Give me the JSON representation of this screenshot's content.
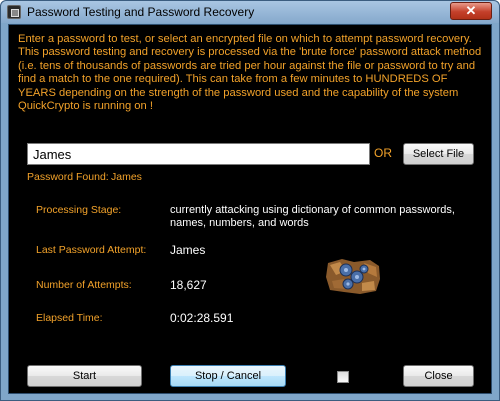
{
  "window": {
    "title": "Password Testing and Password Recovery",
    "close_glyph": "✕"
  },
  "intro_text": "Enter a password to test, or select an encrypted file on which to attempt password recovery.  This password testing and recovery is processed via the  'brute force' password attack method (i.e. tens of thousands of passwords are tried per hour against the file or password to try and find a match to the one required). This can take from a few minutes to HUNDREDS OF YEARS depending on the strength of the password used and the capability of the system QuickCrypto is running on !",
  "password_input": {
    "value": "James"
  },
  "or_label": "OR",
  "select_file_label": "Select File",
  "password_found": {
    "label": "Password Found:",
    "value": "James"
  },
  "fields": {
    "processing_stage": {
      "label": "Processing Stage:",
      "value": "currently attacking using dictionary of common passwords, names, numbers, and words"
    },
    "last_attempt": {
      "label": "Last Password Attempt:",
      "value": "James"
    },
    "attempts": {
      "label": "Number of Attempts:",
      "value": "18,627"
    },
    "elapsed": {
      "label": "Elapsed Time:",
      "value": "0:02:28.591"
    }
  },
  "buttons": {
    "start": "Start",
    "stop_cancel": "Stop / Cancel",
    "close": "Close"
  },
  "checkbox": {
    "checked": false
  },
  "colors": {
    "accent_text": "#f2a22a",
    "background": "#000000",
    "value_text": "#ffffff"
  },
  "icons": {
    "app": "app-icon",
    "progress": "padlock-cracking-animation-icon"
  }
}
